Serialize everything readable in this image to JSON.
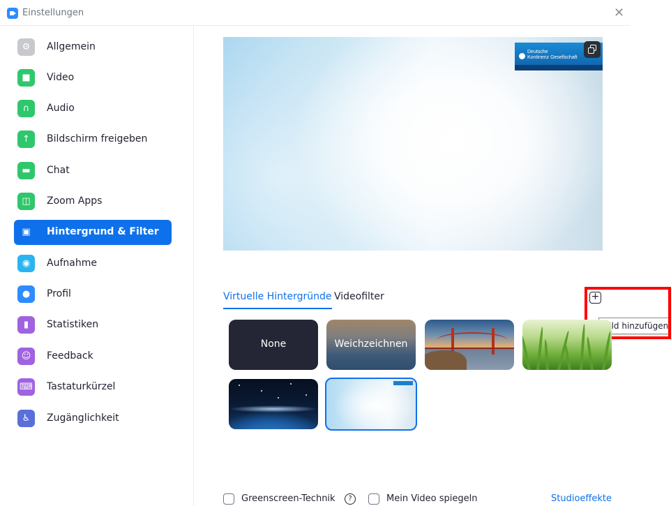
{
  "window": {
    "title": "Einstellungen",
    "close_icon": "close-icon",
    "close_glyph": "✕"
  },
  "sidebar": {
    "active_index": 6,
    "items": [
      {
        "label": "Allgemein",
        "icon": "gear-icon",
        "color": "#c7c9cd",
        "glyph": "⚙"
      },
      {
        "label": "Video",
        "icon": "video-camera-icon",
        "color": "#2fc76b",
        "glyph": "■"
      },
      {
        "label": "Audio",
        "icon": "headphones-icon",
        "color": "#2fc76b",
        "glyph": "∩"
      },
      {
        "label": "Bildschirm freigeben",
        "icon": "share-screen-icon",
        "color": "#2fc76b",
        "glyph": "↑"
      },
      {
        "label": "Chat",
        "icon": "chat-bubble-icon",
        "color": "#2fc76b",
        "glyph": "▬"
      },
      {
        "label": "Zoom Apps",
        "icon": "apps-icon",
        "color": "#2fc76b",
        "glyph": "◫"
      },
      {
        "label": "Hintergrund & Filter",
        "icon": "background-filter-icon",
        "color": "#0e71eb",
        "glyph": "▣"
      },
      {
        "label": "Aufnahme",
        "icon": "record-icon",
        "color": "#2bb5f0",
        "glyph": "◉"
      },
      {
        "label": "Profil",
        "icon": "profile-icon",
        "color": "#2d8cff",
        "glyph": "●"
      },
      {
        "label": "Statistiken",
        "icon": "statistics-icon",
        "color": "#a063e0",
        "glyph": "▮"
      },
      {
        "label": "Feedback",
        "icon": "feedback-icon",
        "color": "#a063e0",
        "glyph": "☺"
      },
      {
        "label": "Tastaturkürzel",
        "icon": "keyboard-icon",
        "color": "#a063e0",
        "glyph": "⌨"
      },
      {
        "label": "Zugänglichkeit",
        "icon": "accessibility-icon",
        "color": "#5b6fd9",
        "glyph": "♿"
      }
    ]
  },
  "preview": {
    "logo_line1": "Deutsche",
    "logo_line2": "Kontinenz Gesellschaft",
    "restore_icon": "restore-window-icon"
  },
  "tabs": [
    {
      "label": "Virtuelle Hintergründe",
      "active": true
    },
    {
      "label": "Videofilter",
      "active": false
    }
  ],
  "add_button": {
    "icon": "plus-icon",
    "glyph": "+",
    "tooltip": "Bild hinzufügen"
  },
  "backgrounds": [
    {
      "label": "None",
      "kind": "none"
    },
    {
      "label": "Weichzeichnen",
      "kind": "blur"
    },
    {
      "label": "",
      "kind": "golden-gate-bridge-image"
    },
    {
      "label": "",
      "kind": "grass-image"
    },
    {
      "label": "",
      "kind": "earth-from-space-image"
    },
    {
      "label": "",
      "kind": "custom-light-blue-image",
      "selected": true
    }
  ],
  "options": {
    "greenscreen_label": "Greenscreen-Technik",
    "greenscreen_checked": false,
    "help_glyph": "?",
    "mirror_label": "Mein Video spiegeln",
    "mirror_checked": false,
    "studio_link": "Studioeffekte"
  },
  "colors": {
    "accent": "#0e71eb",
    "highlight_box": "#ff0000"
  }
}
